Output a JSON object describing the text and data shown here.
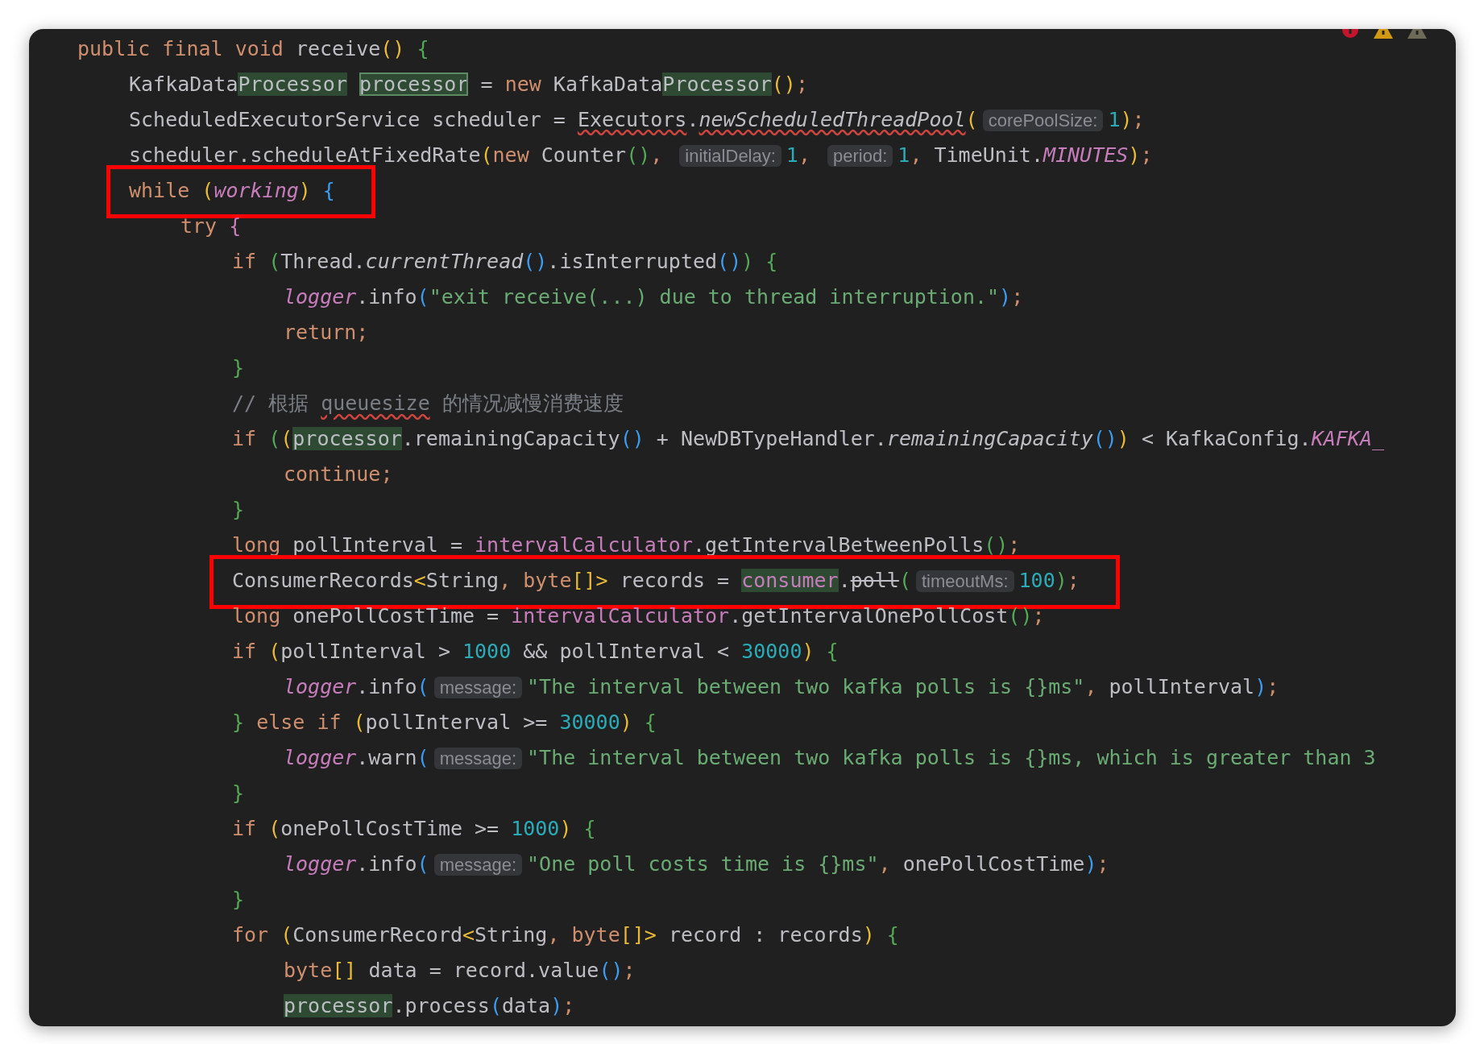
{
  "status_icons": [
    {
      "kind": "error"
    },
    {
      "kind": "warning"
    },
    {
      "kind": "weak-warning"
    }
  ],
  "lines": [
    {
      "boxed": false,
      "tokens": [
        {
          "kind": "keyword",
          "text": "public final void "
        },
        {
          "kind": "plain",
          "text": "receive"
        },
        {
          "kind": "bracket",
          "color": "#e8ba36",
          "text": "()"
        },
        {
          "kind": "bracket",
          "color": "#54a857",
          "text": " {"
        }
      ],
      "children": [
        {
          "boxed": false,
          "tokens": [
            {
              "kind": "plain",
              "text": "KafkaData"
            },
            {
              "kind": "plain",
              "text": "Processor",
              "highlight": true
            },
            {
              "kind": "plain",
              "text": " processor",
              "highlight": true,
              "outlined": true
            },
            {
              "kind": "plain",
              "text": " = "
            },
            {
              "kind": "keyword",
              "text": "new "
            },
            {
              "kind": "plain",
              "text": "KafkaData"
            },
            {
              "kind": "plain",
              "text": "Processor",
              "highlight": true
            },
            {
              "kind": "bracket",
              "color": "#e8ba36",
              "text": "()"
            },
            {
              "kind": "keyword",
              "text": ";"
            }
          ]
        },
        {
          "boxed": false,
          "tokens": [
            {
              "kind": "plain",
              "text": "ScheduledExecutorService scheduler = "
            },
            {
              "kind": "plain",
              "text": "Executors",
              "wavy": true
            },
            {
              "kind": "plain",
              "text": "."
            },
            {
              "kind": "static",
              "text": "newScheduledThreadPool",
              "wavy": true
            },
            {
              "kind": "bracket",
              "color": "#e8ba36",
              "text": "("
            },
            {
              "kind": "hint",
              "text": "corePoolSize:"
            },
            {
              "kind": "number",
              "text": "1"
            },
            {
              "kind": "bracket",
              "color": "#e8ba36",
              "text": ")"
            },
            {
              "kind": "keyword",
              "text": ";"
            }
          ]
        },
        {
          "boxed": false,
          "tokens": [
            {
              "kind": "plain",
              "text": "scheduler.scheduleAtFixedRate"
            },
            {
              "kind": "bracket",
              "color": "#e8ba36",
              "text": "("
            },
            {
              "kind": "keyword",
              "text": "new "
            },
            {
              "kind": "plain",
              "text": "Counter"
            },
            {
              "kind": "bracket",
              "color": "#54a857",
              "text": "()"
            },
            {
              "kind": "keyword",
              "text": ", "
            },
            {
              "kind": "hint",
              "text": "initialDelay:"
            },
            {
              "kind": "number",
              "text": "1"
            },
            {
              "kind": "keyword",
              "text": ", "
            },
            {
              "kind": "hint",
              "text": "period:"
            },
            {
              "kind": "number",
              "text": "1"
            },
            {
              "kind": "keyword",
              "text": ", "
            },
            {
              "kind": "plain",
              "text": "TimeUnit."
            },
            {
              "kind": "field",
              "text": "MINUTES"
            },
            {
              "kind": "bracket",
              "color": "#e8ba36",
              "text": ")"
            },
            {
              "kind": "keyword",
              "text": ";"
            }
          ]
        },
        {
          "boxed": true,
          "tokens": [
            {
              "kind": "keyword",
              "text": "while "
            },
            {
              "kind": "bracket",
              "color": "#e8ba36",
              "text": "("
            },
            {
              "kind": "field",
              "text": "working"
            },
            {
              "kind": "bracket",
              "color": "#e8ba36",
              "text": ")"
            },
            {
              "kind": "bracket",
              "color": "#3d9cf0",
              "text": " {"
            }
          ],
          "children": [
            {
              "boxed": false,
              "tokens": [
                {
                  "kind": "keyword",
                  "text": "try "
                },
                {
                  "kind": "bracket",
                  "color": "#c77dbb",
                  "text": "{"
                }
              ],
              "children": [
                {
                  "boxed": false,
                  "tokens": [
                    {
                      "kind": "keyword",
                      "text": "if "
                    },
                    {
                      "kind": "bracket",
                      "color": "#54a857",
                      "text": "("
                    },
                    {
                      "kind": "plain",
                      "text": "Thread."
                    },
                    {
                      "kind": "static",
                      "text": "currentThread"
                    },
                    {
                      "kind": "bracket",
                      "color": "#3d9cf0",
                      "text": "()"
                    },
                    {
                      "kind": "plain",
                      "text": ".isInterrupted"
                    },
                    {
                      "kind": "bracket",
                      "color": "#3d9cf0",
                      "text": "()"
                    },
                    {
                      "kind": "bracket",
                      "color": "#54a857",
                      "text": ")"
                    },
                    {
                      "kind": "bracket",
                      "color": "#54a857",
                      "text": " {"
                    }
                  ],
                  "children": [
                    {
                      "boxed": false,
                      "tokens": [
                        {
                          "kind": "field",
                          "text": "logger"
                        },
                        {
                          "kind": "plain",
                          "text": ".info"
                        },
                        {
                          "kind": "bracket",
                          "color": "#3d9cf0",
                          "text": "("
                        },
                        {
                          "kind": "string",
                          "text": "\"exit receive(...) due to thread interruption.\""
                        },
                        {
                          "kind": "bracket",
                          "color": "#3d9cf0",
                          "text": ")"
                        },
                        {
                          "kind": "keyword",
                          "text": ";"
                        }
                      ]
                    },
                    {
                      "boxed": false,
                      "tokens": [
                        {
                          "kind": "keyword",
                          "text": "return;"
                        }
                      ]
                    }
                  ]
                },
                {
                  "boxed": false,
                  "tokens": [
                    {
                      "kind": "bracket",
                      "color": "#54a857",
                      "text": "}"
                    }
                  ]
                },
                {
                  "boxed": false,
                  "tokens": [
                    {
                      "kind": "comment",
                      "text": "// 根据 "
                    },
                    {
                      "kind": "comment",
                      "text": "queuesize",
                      "wavy": true
                    },
                    {
                      "kind": "comment",
                      "text": " 的情况减慢消费速度"
                    }
                  ]
                },
                {
                  "boxed": false,
                  "tokens": [
                    {
                      "kind": "keyword",
                      "text": "if "
                    },
                    {
                      "kind": "bracket",
                      "color": "#54a857",
                      "text": "("
                    },
                    {
                      "kind": "bracket",
                      "color": "#e8ba36",
                      "text": "("
                    },
                    {
                      "kind": "plain",
                      "text": "processor",
                      "highlight": true
                    },
                    {
                      "kind": "plain",
                      "text": ".remainingCapacity"
                    },
                    {
                      "kind": "bracket",
                      "color": "#3d9cf0",
                      "text": "()"
                    },
                    {
                      "kind": "plain",
                      "text": " + NewDBTypeHandler."
                    },
                    {
                      "kind": "static",
                      "text": "remainingCapacity"
                    },
                    {
                      "kind": "bracket",
                      "color": "#3d9cf0",
                      "text": "()"
                    },
                    {
                      "kind": "bracket",
                      "color": "#e8ba36",
                      "text": ")"
                    },
                    {
                      "kind": "plain",
                      "text": " < KafkaConfig."
                    },
                    {
                      "kind": "field",
                      "text": "KAFKA_"
                    }
                  ],
                  "children": [
                    {
                      "boxed": false,
                      "tokens": [
                        {
                          "kind": "keyword",
                          "text": "continue;"
                        }
                      ]
                    }
                  ]
                },
                {
                  "boxed": false,
                  "tokens": [
                    {
                      "kind": "bracket",
                      "color": "#54a857",
                      "text": "}"
                    }
                  ]
                },
                {
                  "boxed": false,
                  "tokens": [
                    {
                      "kind": "keyword",
                      "text": "long "
                    },
                    {
                      "kind": "plain",
                      "text": "pollInterval = "
                    },
                    {
                      "kind": "member",
                      "text": "intervalCalculator"
                    },
                    {
                      "kind": "plain",
                      "text": ".getIntervalBetweenPolls"
                    },
                    {
                      "kind": "bracket",
                      "color": "#54a857",
                      "text": "()"
                    },
                    {
                      "kind": "keyword",
                      "text": ";"
                    }
                  ]
                },
                {
                  "boxed": true,
                  "tokens": [
                    {
                      "kind": "plain",
                      "text": "ConsumerRecords"
                    },
                    {
                      "kind": "bracket",
                      "color": "#e8ba36",
                      "text": "<"
                    },
                    {
                      "kind": "plain",
                      "text": "String"
                    },
                    {
                      "kind": "keyword",
                      "text": ", byte"
                    },
                    {
                      "kind": "bracket",
                      "color": "#e8ba36",
                      "text": "[]>"
                    },
                    {
                      "kind": "plain",
                      "text": " records = "
                    },
                    {
                      "kind": "member",
                      "text": "consumer",
                      "highlight": true
                    },
                    {
                      "kind": "plain",
                      "text": "."
                    },
                    {
                      "kind": "plain",
                      "text": "poll",
                      "struck": true
                    },
                    {
                      "kind": "bracket",
                      "color": "#54a857",
                      "text": "("
                    },
                    {
                      "kind": "hint",
                      "text": "timeoutMs:"
                    },
                    {
                      "kind": "number",
                      "text": "100"
                    },
                    {
                      "kind": "bracket",
                      "color": "#54a857",
                      "text": ")"
                    },
                    {
                      "kind": "keyword",
                      "text": ";"
                    }
                  ]
                },
                {
                  "boxed": false,
                  "tokens": [
                    {
                      "kind": "keyword",
                      "text": "long "
                    },
                    {
                      "kind": "plain",
                      "text": "onePollCostTime = "
                    },
                    {
                      "kind": "member",
                      "text": "intervalCalculator"
                    },
                    {
                      "kind": "plain",
                      "text": ".getIntervalOnePollCost"
                    },
                    {
                      "kind": "bracket",
                      "color": "#54a857",
                      "text": "()"
                    },
                    {
                      "kind": "keyword",
                      "text": ";"
                    }
                  ]
                },
                {
                  "boxed": false,
                  "tokens": [
                    {
                      "kind": "keyword",
                      "text": "if "
                    },
                    {
                      "kind": "bracket",
                      "color": "#e8ba36",
                      "text": "("
                    },
                    {
                      "kind": "plain",
                      "text": "pollInterval > "
                    },
                    {
                      "kind": "number",
                      "text": "1000"
                    },
                    {
                      "kind": "plain",
                      "text": " && pollInterval < "
                    },
                    {
                      "kind": "number",
                      "text": "30000"
                    },
                    {
                      "kind": "bracket",
                      "color": "#e8ba36",
                      "text": ")"
                    },
                    {
                      "kind": "bracket",
                      "color": "#54a857",
                      "text": " {"
                    }
                  ],
                  "children": [
                    {
                      "boxed": false,
                      "tokens": [
                        {
                          "kind": "field",
                          "text": "logger"
                        },
                        {
                          "kind": "plain",
                          "text": ".info"
                        },
                        {
                          "kind": "bracket",
                          "color": "#3d9cf0",
                          "text": "("
                        },
                        {
                          "kind": "hint",
                          "text": "message:"
                        },
                        {
                          "kind": "string",
                          "text": "\"The interval between two kafka polls is {}ms\""
                        },
                        {
                          "kind": "keyword",
                          "text": ", "
                        },
                        {
                          "kind": "plain",
                          "text": "pollInterval"
                        },
                        {
                          "kind": "bracket",
                          "color": "#3d9cf0",
                          "text": ")"
                        },
                        {
                          "kind": "keyword",
                          "text": ";"
                        }
                      ]
                    }
                  ]
                },
                {
                  "boxed": false,
                  "tokens": [
                    {
                      "kind": "bracket",
                      "color": "#54a857",
                      "text": "}"
                    },
                    {
                      "kind": "keyword",
                      "text": " else if "
                    },
                    {
                      "kind": "bracket",
                      "color": "#e8ba36",
                      "text": "("
                    },
                    {
                      "kind": "plain",
                      "text": "pollInterval >= "
                    },
                    {
                      "kind": "number",
                      "text": "30000"
                    },
                    {
                      "kind": "bracket",
                      "color": "#e8ba36",
                      "text": ")"
                    },
                    {
                      "kind": "bracket",
                      "color": "#54a857",
                      "text": " {"
                    }
                  ],
                  "children": [
                    {
                      "boxed": false,
                      "tokens": [
                        {
                          "kind": "field",
                          "text": "logger"
                        },
                        {
                          "kind": "plain",
                          "text": ".warn"
                        },
                        {
                          "kind": "bracket",
                          "color": "#3d9cf0",
                          "text": "("
                        },
                        {
                          "kind": "hint",
                          "text": "message:"
                        },
                        {
                          "kind": "string",
                          "text": "\"The interval between two kafka polls is {}ms, which is greater than 3"
                        }
                      ]
                    }
                  ]
                },
                {
                  "boxed": false,
                  "tokens": [
                    {
                      "kind": "bracket",
                      "color": "#54a857",
                      "text": "}"
                    }
                  ]
                },
                {
                  "boxed": false,
                  "tokens": [
                    {
                      "kind": "keyword",
                      "text": "if "
                    },
                    {
                      "kind": "bracket",
                      "color": "#e8ba36",
                      "text": "("
                    },
                    {
                      "kind": "plain",
                      "text": "onePollCostTime >= "
                    },
                    {
                      "kind": "number",
                      "text": "1000"
                    },
                    {
                      "kind": "bracket",
                      "color": "#e8ba36",
                      "text": ")"
                    },
                    {
                      "kind": "bracket",
                      "color": "#54a857",
                      "text": " {"
                    }
                  ],
                  "children": [
                    {
                      "boxed": false,
                      "tokens": [
                        {
                          "kind": "field",
                          "text": "logger"
                        },
                        {
                          "kind": "plain",
                          "text": ".info"
                        },
                        {
                          "kind": "bracket",
                          "color": "#3d9cf0",
                          "text": "("
                        },
                        {
                          "kind": "hint",
                          "text": "message:"
                        },
                        {
                          "kind": "string",
                          "text": "\"One poll costs time is {}ms\""
                        },
                        {
                          "kind": "keyword",
                          "text": ", "
                        },
                        {
                          "kind": "plain",
                          "text": "onePollCostTime"
                        },
                        {
                          "kind": "bracket",
                          "color": "#3d9cf0",
                          "text": ")"
                        },
                        {
                          "kind": "keyword",
                          "text": ";"
                        }
                      ]
                    }
                  ]
                },
                {
                  "boxed": false,
                  "tokens": [
                    {
                      "kind": "bracket",
                      "color": "#54a857",
                      "text": "}"
                    }
                  ]
                },
                {
                  "boxed": false,
                  "tokens": [
                    {
                      "kind": "keyword",
                      "text": "for "
                    },
                    {
                      "kind": "bracket",
                      "color": "#e8ba36",
                      "text": "("
                    },
                    {
                      "kind": "plain",
                      "text": "ConsumerRecord"
                    },
                    {
                      "kind": "bracket",
                      "color": "#e8ba36",
                      "text": "<"
                    },
                    {
                      "kind": "plain",
                      "text": "String"
                    },
                    {
                      "kind": "keyword",
                      "text": ", byte"
                    },
                    {
                      "kind": "bracket",
                      "color": "#e8ba36",
                      "text": "[]>"
                    },
                    {
                      "kind": "plain",
                      "text": " record : records"
                    },
                    {
                      "kind": "bracket",
                      "color": "#e8ba36",
                      "text": ")"
                    },
                    {
                      "kind": "bracket",
                      "color": "#54a857",
                      "text": " {"
                    }
                  ],
                  "children": [
                    {
                      "boxed": false,
                      "tokens": [
                        {
                          "kind": "keyword",
                          "text": "byte"
                        },
                        {
                          "kind": "bracket",
                          "color": "#e8ba36",
                          "text": "[]"
                        },
                        {
                          "kind": "plain",
                          "text": " data = record.value"
                        },
                        {
                          "kind": "bracket",
                          "color": "#3d9cf0",
                          "text": "()"
                        },
                        {
                          "kind": "keyword",
                          "text": ";"
                        }
                      ]
                    },
                    {
                      "boxed": false,
                      "tokens": [
                        {
                          "kind": "plain",
                          "text": "processor",
                          "highlight": true
                        },
                        {
                          "kind": "plain",
                          "text": ".process"
                        },
                        {
                          "kind": "bracket",
                          "color": "#3d9cf0",
                          "text": "("
                        },
                        {
                          "kind": "plain",
                          "text": "data"
                        },
                        {
                          "kind": "bracket",
                          "color": "#3d9cf0",
                          "text": ")"
                        },
                        {
                          "kind": "keyword",
                          "text": ";"
                        }
                      ]
                    }
                  ]
                }
              ]
            }
          ]
        }
      ]
    }
  ]
}
